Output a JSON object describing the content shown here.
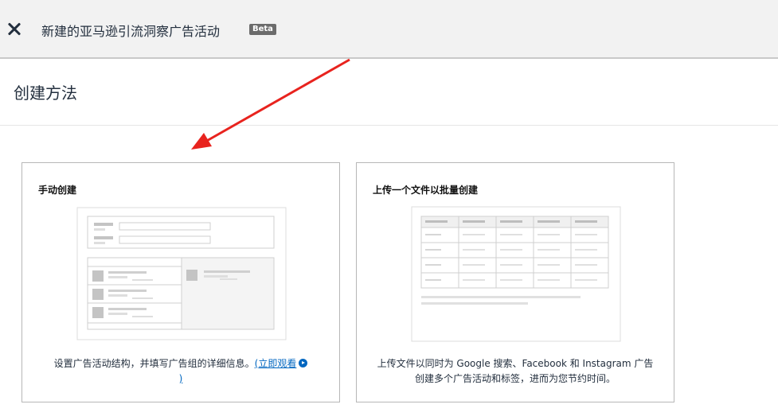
{
  "header": {
    "close_icon": "close-icon",
    "title": "新建的亚马逊引流洞察广告活动",
    "badge": "Beta"
  },
  "section": {
    "title": "创建方法"
  },
  "annotation": {
    "arrow_color": "#e8231e"
  },
  "cards": [
    {
      "title": "手动创建",
      "description": "设置广告活动结构，并填写广告组的详细信息。",
      "link_text": "立即观看",
      "link_open": "(",
      "link_close": ")",
      "illustration": "manual-create-illustration"
    },
    {
      "title": "上传一个文件以批量创建",
      "description_line1": "上传文件以同时为 Google 搜索、Facebook 和 Instagram 广告",
      "description_line2": "创建多个广告活动和标签，进而为您节约时间。",
      "illustration": "spreadsheet-illustration"
    }
  ],
  "colors": {
    "header_bg": "#f2f2f2",
    "link": "#0066c0",
    "text": "#232f3e"
  }
}
